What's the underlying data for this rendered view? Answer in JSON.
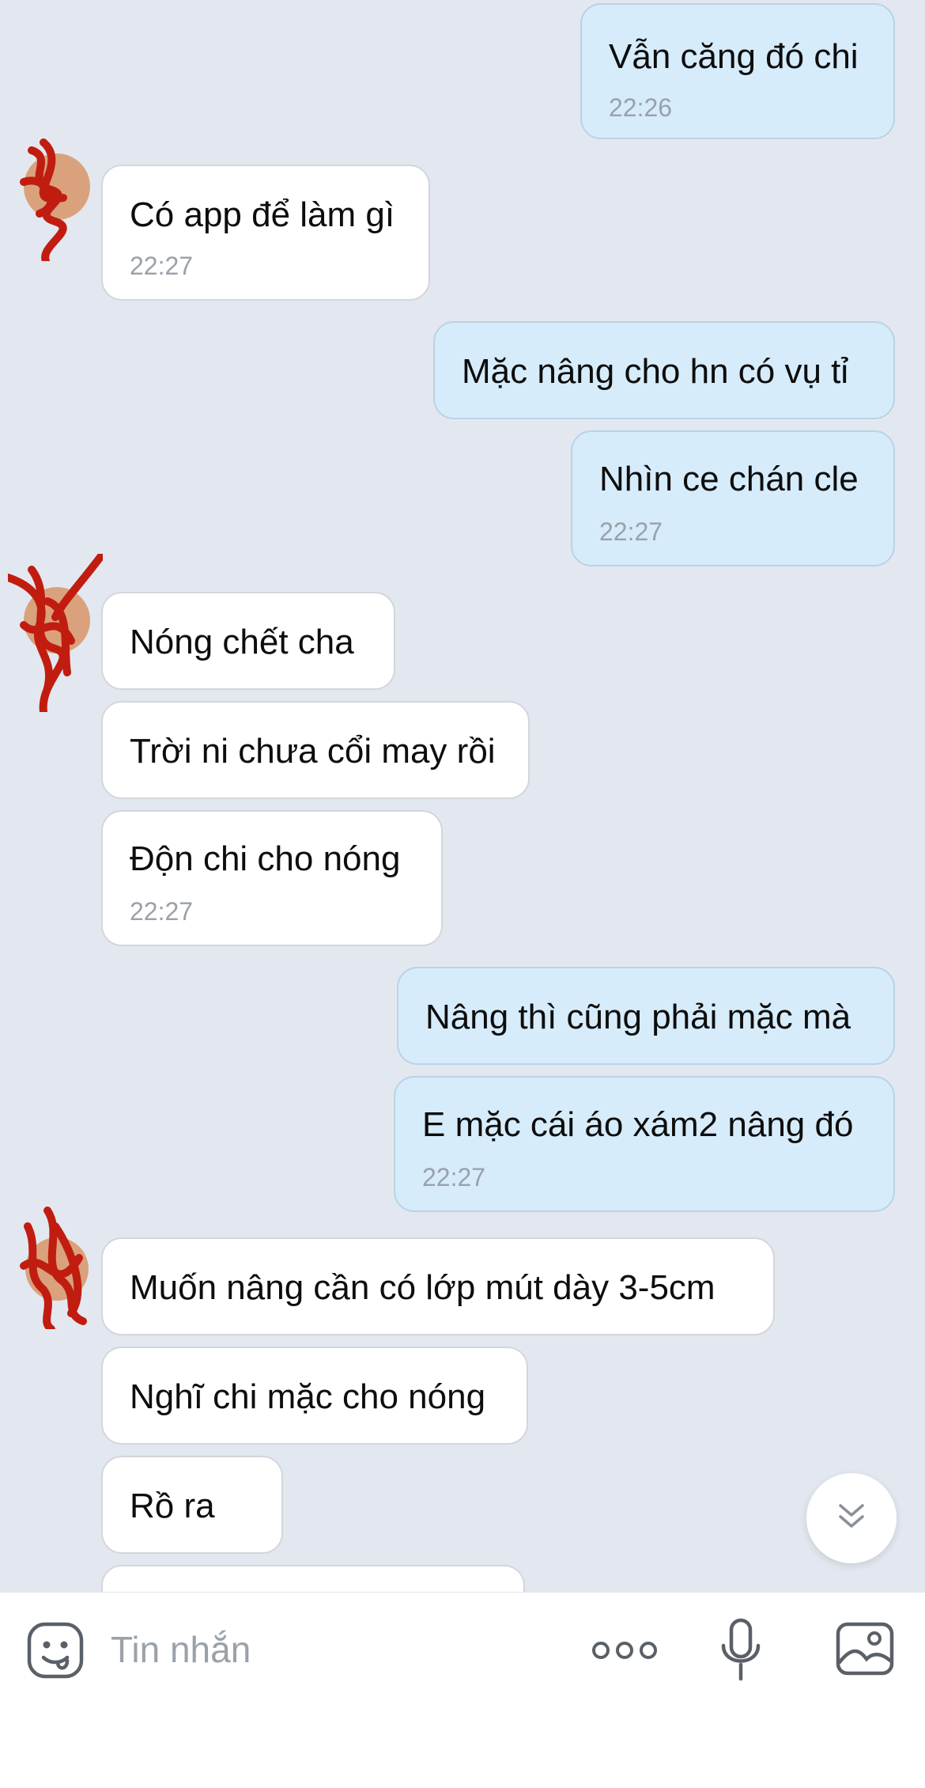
{
  "messages": [
    {
      "side": "out",
      "text": "Vẫn căng đó chi",
      "time": "22:26"
    },
    {
      "side": "in",
      "text": "Có app để làm gì",
      "time": "22:27"
    },
    {
      "side": "out",
      "text": "Mặc nâng cho hn có vụ tỉ",
      "time": ""
    },
    {
      "side": "out",
      "text": "Nhìn ce chán cle",
      "time": "22:27"
    },
    {
      "side": "in",
      "text": "Nóng chết cha",
      "time": ""
    },
    {
      "side": "in",
      "text": "Trời ni chưa cổi may rồi",
      "time": ""
    },
    {
      "side": "in",
      "text": "Độn chi cho nóng",
      "time": "22:27"
    },
    {
      "side": "out",
      "text": "Nâng thì cũng phải mặc mà",
      "time": ""
    },
    {
      "side": "out",
      "text": "E mặc cái áo xám2 nâng đó",
      "time": "22:27"
    },
    {
      "side": "in",
      "text": "Muốn nâng cần có lớp mút dày 3-5cm",
      "time": ""
    },
    {
      "side": "in",
      "text": "Nghĩ chi mặc cho nóng",
      "time": ""
    },
    {
      "side": "in",
      "text": "Rồ ra",
      "time": ""
    },
    {
      "side": "in",
      "text": "",
      "time": ""
    }
  ],
  "composer": {
    "placeholder": "Tin nhắn",
    "icons": {
      "emoji": "emoji-icon",
      "more": "more-icon",
      "microphone": "microphone-icon",
      "image": "image-icon"
    }
  },
  "scroll_button_icon": "chevron-double-down-icon",
  "colors": {
    "background": "#e3e8f0",
    "outgoing_bubble": "#d6ecfb",
    "incoming_bubble": "#ffffff",
    "time_text": "#9aa1a9",
    "avatar_scribble": "#c01d10"
  }
}
